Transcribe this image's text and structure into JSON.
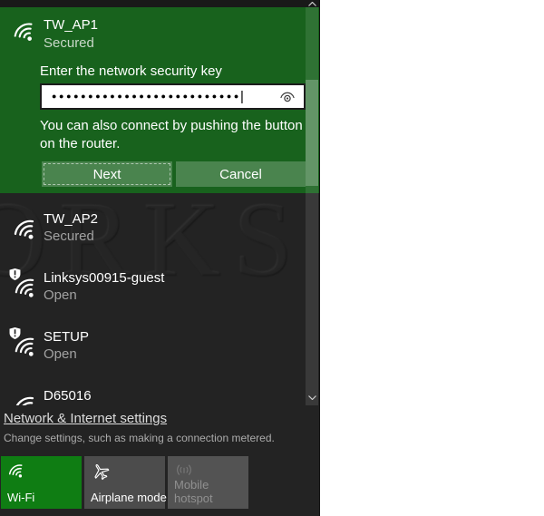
{
  "flyout": {
    "selected": {
      "name": "TW_AP1",
      "status": "Secured",
      "prompt": "Enter the network security key",
      "password_dots": "●●●●●●●●●●●●●●●●●●●●●●●●●●",
      "cursor": "|",
      "note": "You can also connect by pushing the button on the router.",
      "buttons": {
        "next": "Next",
        "cancel": "Cancel"
      }
    },
    "networks": [
      {
        "name": "TW_AP2",
        "status": "Secured"
      },
      {
        "name": "Linksys00915-guest",
        "status": "Open"
      },
      {
        "name": "SETUP",
        "status": "Open"
      },
      {
        "name": "D65016",
        "status": ""
      }
    ],
    "watermark": "ORKS",
    "footer": {
      "link": "Network & Internet settings",
      "caption": "Change settings, such as making a connection metered.",
      "tiles": [
        {
          "label": "Wi-Fi",
          "state": "on"
        },
        {
          "label": "Airplane mode",
          "state": "off"
        },
        {
          "label": "Mobile hotspot",
          "state": "disabled"
        }
      ]
    },
    "colors": {
      "selected_green": "#18621d",
      "tile_green": "#0f7d13",
      "panel_bg": "#232323"
    }
  }
}
